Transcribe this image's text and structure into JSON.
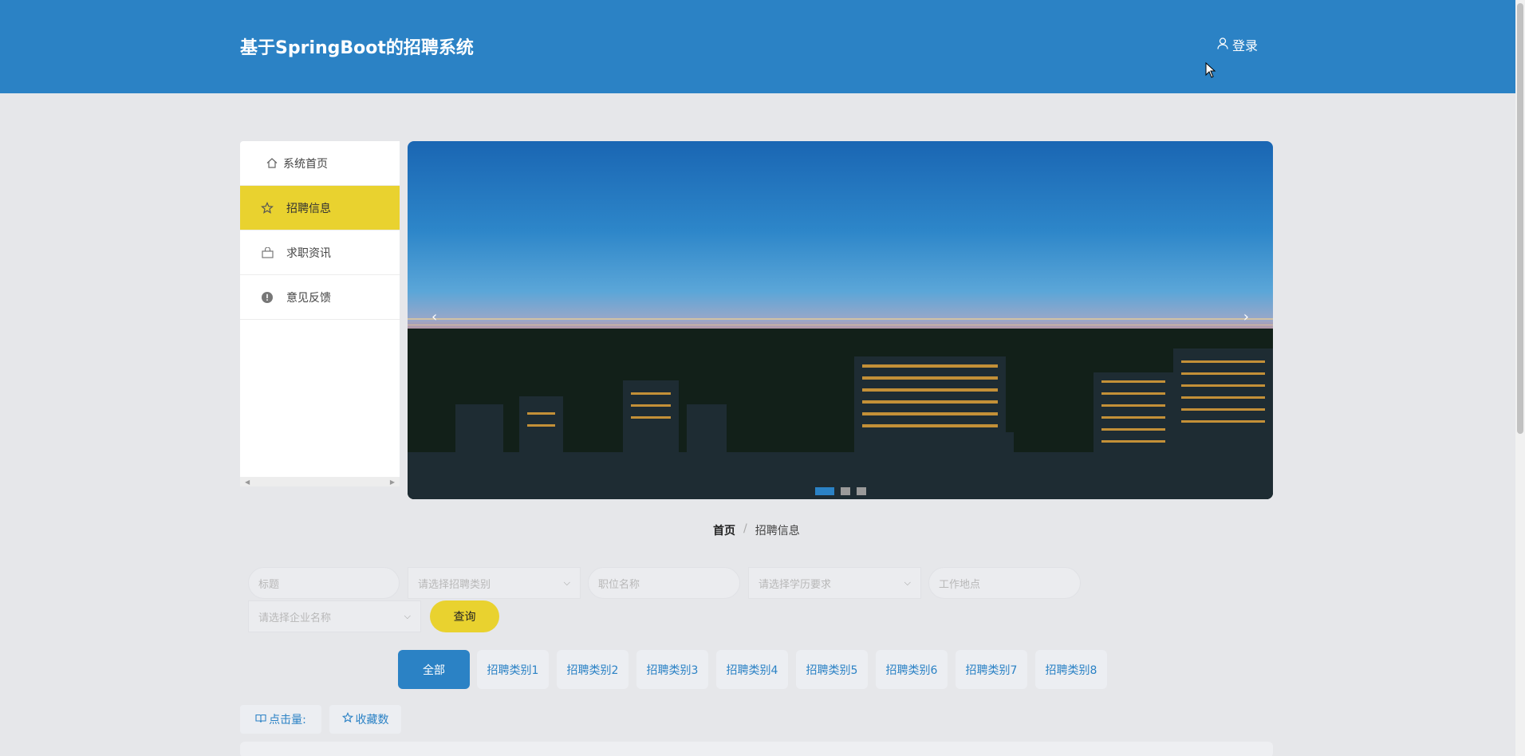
{
  "header": {
    "title": "基于SpringBoot的招聘系统",
    "login_label": "登录"
  },
  "sidebar": {
    "items": [
      {
        "label": "系统首页",
        "icon": "home-icon"
      },
      {
        "label": "招聘信息",
        "icon": "star-icon",
        "active": true
      },
      {
        "label": "求职资讯",
        "icon": "bag-icon"
      },
      {
        "label": "意见反馈",
        "icon": "alert-icon"
      }
    ]
  },
  "banner": {
    "slides": 3,
    "active_slide": 1
  },
  "breadcrumb": {
    "home": "首页",
    "separator": "/",
    "current": "招聘信息"
  },
  "filters": {
    "title_placeholder": "标题",
    "category_placeholder": "请选择招聘类别",
    "position_placeholder": "职位名称",
    "education_placeholder": "请选择学历要求",
    "location_placeholder": "工作地点",
    "company_placeholder": "请选择企业名称",
    "query_label": "查询"
  },
  "tabs": [
    "全部",
    "招聘类别1",
    "招聘类别2",
    "招聘类别3",
    "招聘类别4",
    "招聘类别5",
    "招聘类别6",
    "招聘类别7",
    "招聘类别8"
  ],
  "sort": {
    "clicks_label": "点击量:",
    "favorites_label": "收藏数"
  },
  "colors": {
    "primary": "#2b82c5",
    "accent": "#e9d22f",
    "background": "#e6e7ea"
  }
}
